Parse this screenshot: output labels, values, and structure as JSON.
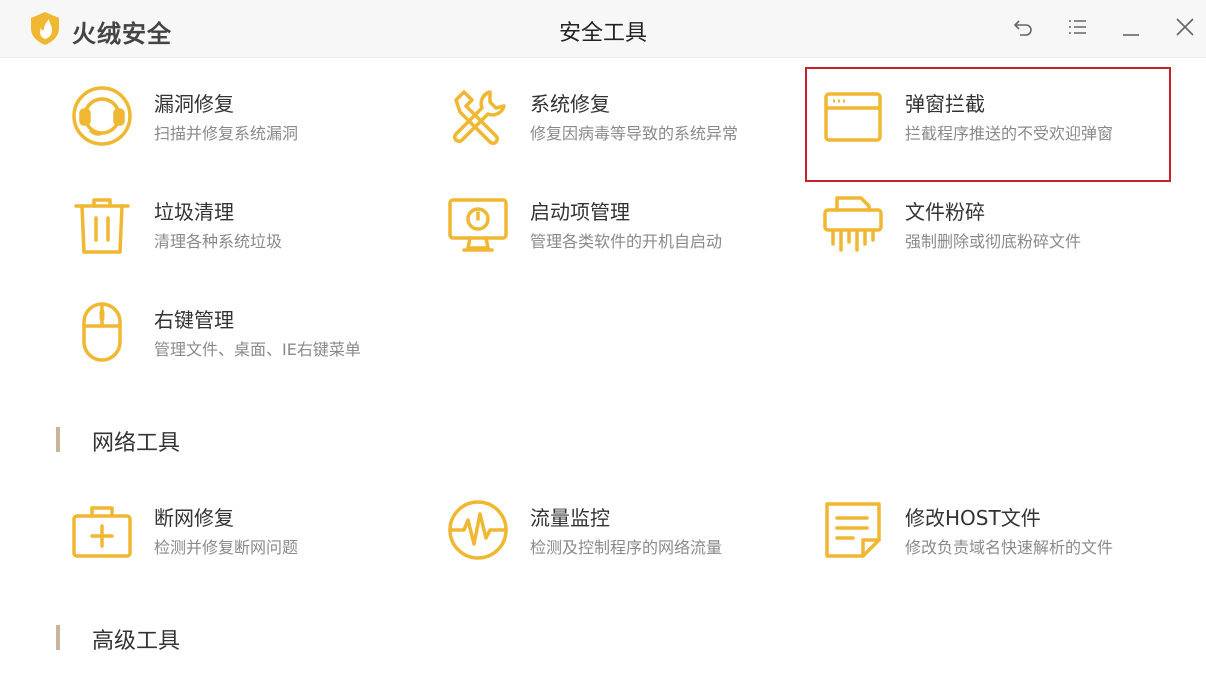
{
  "app": {
    "name": "火绒安全",
    "window_title": "安全工具"
  },
  "controls": {
    "back": "back-icon",
    "menu": "menu-icon",
    "minimize": "minimize-icon",
    "close": "close-icon"
  },
  "colors": {
    "accent": "#f0b732",
    "highlight_border": "#c8232c",
    "section_bar": "#c9b49a"
  },
  "security_tools": [
    {
      "title": "漏洞修复",
      "desc": "扫描并修复系统漏洞",
      "icon": "lifebuoy-icon"
    },
    {
      "title": "系统修复",
      "desc": "修复因病毒等导致的系统异常",
      "icon": "tools-icon"
    },
    {
      "title": "弹窗拦截",
      "desc": "拦截程序推送的不受欢迎弹窗",
      "icon": "window-icon"
    },
    {
      "title": "垃圾清理",
      "desc": "清理各种系统垃圾",
      "icon": "trash-icon"
    },
    {
      "title": "启动项管理",
      "desc": "管理各类软件的开机自启动",
      "icon": "monitor-icon"
    },
    {
      "title": "文件粉碎",
      "desc": "强制删除或彻底粉碎文件",
      "icon": "shredder-icon"
    },
    {
      "title": "右键管理",
      "desc": "管理文件、桌面、IE右键菜单",
      "icon": "mouse-icon"
    }
  ],
  "network_section": {
    "title": "网络工具"
  },
  "network_tools": [
    {
      "title": "断网修复",
      "desc": "检测并修复断网问题",
      "icon": "medkit-icon"
    },
    {
      "title": "流量监控",
      "desc": "检测及控制程序的网络流量",
      "icon": "pulse-icon"
    },
    {
      "title": "修改HOST文件",
      "desc": "修改负责域名快速解析的文件",
      "icon": "document-icon"
    }
  ],
  "advanced_section": {
    "title": "高级工具"
  }
}
